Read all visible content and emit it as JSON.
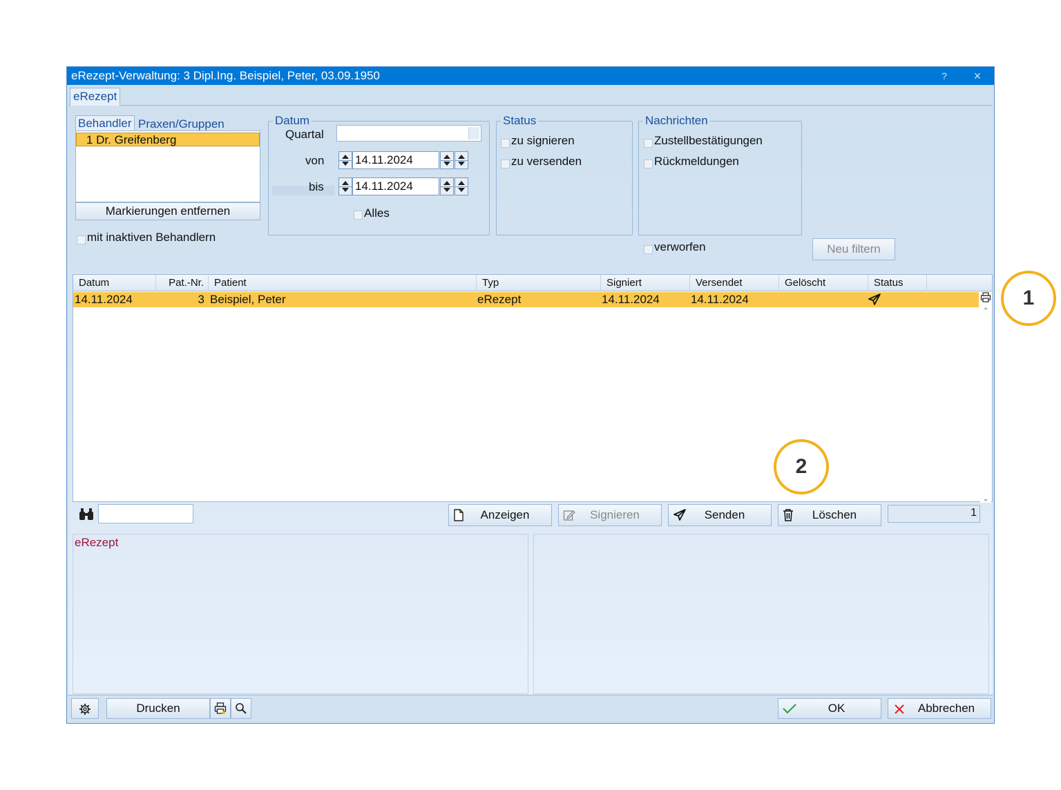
{
  "window": {
    "title": "eRezept-Verwaltung: 3 Dipl.Ing. Beispiel, Peter, 03.09.1950",
    "help_label": "?",
    "close_label": "×"
  },
  "main_tab": "eRezept",
  "behandler": {
    "tabs": [
      "Behandler",
      "Praxen/Gruppen"
    ],
    "items": [
      {
        "label": "1  Dr. Greifenberg",
        "selected": true
      }
    ],
    "clear_button": "Markierungen entfernen",
    "inactive_checkbox": "mit inaktiven Behandlern"
  },
  "datum": {
    "title": "Datum",
    "quartal_label": "Quartal",
    "quartal_value": "",
    "von_label": "von",
    "von_value": "14.11.2024",
    "bis_label": "bis",
    "bis_value": "14.11.2024",
    "alles_label": "Alles"
  },
  "status": {
    "title": "Status",
    "options": [
      "zu signieren",
      "zu versenden"
    ]
  },
  "nachrichten": {
    "title": "Nachrichten",
    "options": [
      "Zustellbestätigungen",
      "Rückmeldungen"
    ],
    "verworfen_label": "verworfen"
  },
  "filter_button": "Neu filtern",
  "table": {
    "columns": [
      "Datum",
      "Pat.-Nr.",
      "Patient",
      "Typ",
      "Signiert",
      "Versendet",
      "Gelöscht",
      "Status"
    ],
    "rows": [
      {
        "datum": "14.11.2024",
        "patnr": "3",
        "patient": "Beispiel, Peter",
        "typ": "eRezept",
        "signiert": "14.11.2024",
        "versendet": "14.11.2024",
        "geloescht": "",
        "status_icon": "send-icon",
        "selected": true
      }
    ]
  },
  "actions": {
    "search_value": "",
    "anzeigen": "Anzeigen",
    "signieren": "Signieren",
    "senden": "Senden",
    "loeschen": "Löschen",
    "count": "1"
  },
  "detail": {
    "left_label": "eRezept"
  },
  "footer": {
    "drucken": "Drucken",
    "ok": "OK",
    "abbrechen": "Abbrechen"
  },
  "callouts": [
    "1",
    "2"
  ],
  "colors": {
    "titlebar": "#0078d7",
    "selection": "#f9c84a",
    "callout": "#f2b21b",
    "link_blue": "#1a4f9c",
    "detail_label": "#a0153e"
  }
}
